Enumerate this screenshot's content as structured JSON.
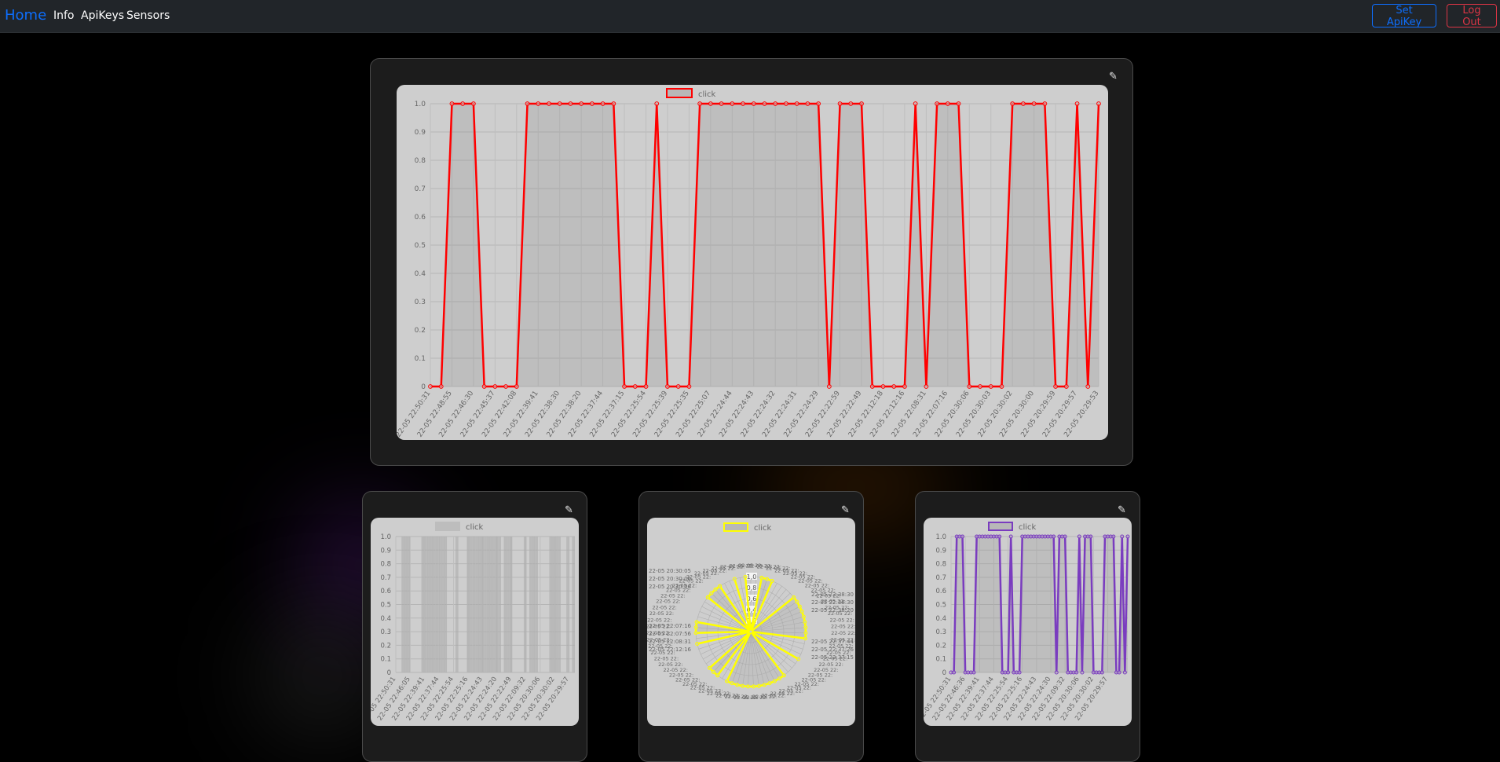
{
  "nav": {
    "brand": "Home",
    "links": [
      "Info",
      "ApiKeys",
      "Sensors"
    ],
    "set_apikey": "Set ApiKey",
    "logout": "Log Out"
  },
  "icons": {
    "edit": "pencil-icon"
  },
  "colors": {
    "background": "#000000",
    "navbar": "#212529",
    "brand": "#0d6efd",
    "logout": "#dc3545",
    "main_line": "#ff0000",
    "pie_line": "#ffff00",
    "small_line": "#7a3cbf",
    "bar": "#bdbdbd"
  },
  "chart_data": [
    {
      "type": "line",
      "legend": "click",
      "ylim": [
        0,
        1
      ],
      "yticks": [
        "0",
        "0.1",
        "0.2",
        "0.3",
        "0.4",
        "0.5",
        "0.6",
        "0.7",
        "0.8",
        "0.9",
        "1.0"
      ],
      "x": [
        "22-05 22:50:31",
        "22-05 22:48:55",
        "22-05 22:46:30",
        "22-05 22:45:37",
        "22-05 22:42:08",
        "22-05 22:39:41",
        "22-05 22:38:30",
        "22-05 22:38:20",
        "22-05 22:37:44",
        "22-05 22:37:15",
        "22-05 22:25:54",
        "22-05 22:25:39",
        "22-05 22:25:35",
        "22-05 22:25:07",
        "22-05 22:24:44",
        "22-05 22:24:43",
        "22-05 22:24:32",
        "22-05 22:24:31",
        "22-05 22:24:29",
        "22-05 22:22:59",
        "22-05 22:22:49",
        "22-05 22:12:18",
        "22-05 22:12:16",
        "22-05 22:08:31",
        "22-05 22:07:16",
        "22-05 20:30:06",
        "22-05 20:30:03",
        "22-05 20:30:02",
        "22-05 20:30:00",
        "22-05 20:29:59",
        "22-05 20:29:57",
        "22-05 20:29:53",
        "22-05 20:29:46"
      ],
      "values": [
        0,
        0,
        1,
        1,
        1,
        0,
        0,
        0,
        0,
        1,
        1,
        1,
        1,
        1,
        1,
        1,
        1,
        1,
        0,
        0,
        0,
        1,
        0,
        0,
        0,
        1,
        1,
        1,
        1,
        1,
        1,
        1,
        1,
        1,
        1,
        1,
        1,
        0,
        1,
        1,
        1,
        0,
        0,
        0,
        0,
        1,
        0,
        1,
        1,
        1,
        0,
        0,
        0,
        0,
        1,
        1,
        1,
        1,
        0,
        0,
        1,
        0,
        1
      ]
    },
    {
      "type": "bar",
      "legend": "click",
      "ylim": [
        0,
        1
      ],
      "yticks": [
        "0",
        "0.1",
        "0.2",
        "0.3",
        "0.4",
        "0.5",
        "0.6",
        "0.7",
        "0.8",
        "0.9",
        "1.0"
      ],
      "x": [
        "22-05 22:50:31",
        "22-05 22:46:05",
        "22-05 22:39:41",
        "22-05 22:37:44",
        "22-05 22:25:54",
        "22-05 22:25:16",
        "22-05 22:24:43",
        "22-05 22:24:20",
        "22-05 22:22:49",
        "22-05 22:09:32",
        "22-05 20:30:06",
        "22-05 20:30:02",
        "22-05 20:29:57"
      ],
      "values": [
        0,
        0,
        1,
        1,
        1,
        0,
        0,
        0,
        0,
        1,
        1,
        1,
        1,
        1,
        1,
        1,
        1,
        1,
        0,
        0,
        0,
        1,
        0,
        0,
        0,
        1,
        1,
        1,
        1,
        1,
        1,
        1,
        1,
        1,
        1,
        1,
        1,
        0,
        1,
        1,
        1,
        0,
        0,
        0,
        0,
        1,
        0,
        1,
        1,
        1,
        0,
        0,
        0,
        0,
        1,
        1,
        1,
        1,
        0,
        0,
        1,
        0,
        1
      ]
    },
    {
      "type": "radar",
      "legend": "click",
      "ticks": [
        "0,2",
        "0,4",
        "0,6",
        "0,8",
        "1,0"
      ],
      "labels_left": [
        "22-05 20:30:05",
        "22-05 20:30:06",
        "22-05 20:30:06",
        "22-05 22:07:16",
        "22-05 22:07:56",
        "22-05 22:08:31",
        "22-05 22:12:16"
      ],
      "labels_right": [
        "22-05 22:38:30",
        "22-05 22:38:30",
        "22-05 22:38:20",
        "22-05 22:37:44",
        "22-05 22:37:26",
        "22-05 22:37:15"
      ],
      "values": [
        0,
        0,
        1,
        1,
        1,
        0,
        0,
        0,
        0,
        1,
        1,
        1,
        1,
        1,
        1,
        1,
        1,
        1,
        0,
        0,
        0,
        1,
        0,
        0,
        0,
        1,
        1,
        1,
        1,
        1,
        1,
        1,
        1,
        1,
        1,
        1,
        1,
        0,
        1,
        1,
        1,
        0,
        0,
        0,
        0,
        1,
        0,
        1,
        1,
        1,
        0,
        0,
        0,
        0,
        1,
        1,
        1,
        1,
        0,
        0,
        1,
        0,
        1
      ]
    },
    {
      "type": "line",
      "legend": "click",
      "ylim": [
        0,
        1
      ],
      "yticks": [
        "0",
        "0.1",
        "0.2",
        "0.3",
        "0.4",
        "0.5",
        "0.6",
        "0.7",
        "0.8",
        "0.9",
        "1.0"
      ],
      "x": [
        "22-05 22:50:31",
        "22-05 22:46:36",
        "22-05 22:39:41",
        "22-05 22:37:44",
        "22-05 22:25:54",
        "22-05 22:25:16",
        "22-05 22:24:43",
        "22-05 22:24:30",
        "22-05 22:09:32",
        "22-05 20:30:06",
        "22-05 20:30:02",
        "22-05 20:29:57"
      ],
      "values": [
        0,
        0,
        1,
        1,
        1,
        0,
        0,
        0,
        0,
        1,
        1,
        1,
        1,
        1,
        1,
        1,
        1,
        1,
        0,
        0,
        0,
        1,
        0,
        0,
        0,
        1,
        1,
        1,
        1,
        1,
        1,
        1,
        1,
        1,
        1,
        1,
        1,
        0,
        1,
        1,
        1,
        0,
        0,
        0,
        0,
        1,
        0,
        1,
        1,
        1,
        0,
        0,
        0,
        0,
        1,
        1,
        1,
        1,
        0,
        0,
        1,
        0,
        1
      ]
    }
  ]
}
